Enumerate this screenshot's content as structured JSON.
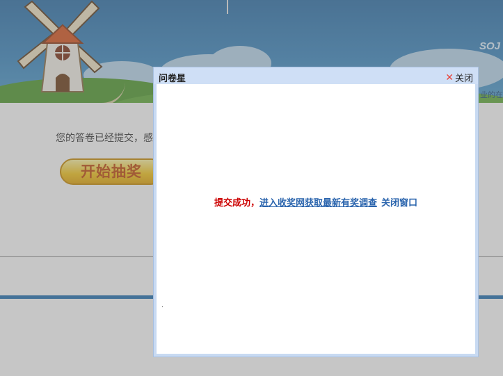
{
  "banner": {
    "logo_text": "SOJ",
    "logo_sub": "业的在"
  },
  "page": {
    "submit_message": "您的答卷已经提交，感",
    "lottery_button": "开始抽奖"
  },
  "dialog": {
    "title": "问卷星",
    "close_label": "关闭",
    "success_text": "提交成功，",
    "link_text": "进入收奖网获取最新有奖调查",
    "close_window_text": "关闭窗口"
  },
  "colors": {
    "success": "#cc0000",
    "link": "#2a64ad",
    "close_icon": "#e8433a",
    "titlebar": "#cfdff6"
  },
  "icons": {
    "close": "close-icon"
  }
}
